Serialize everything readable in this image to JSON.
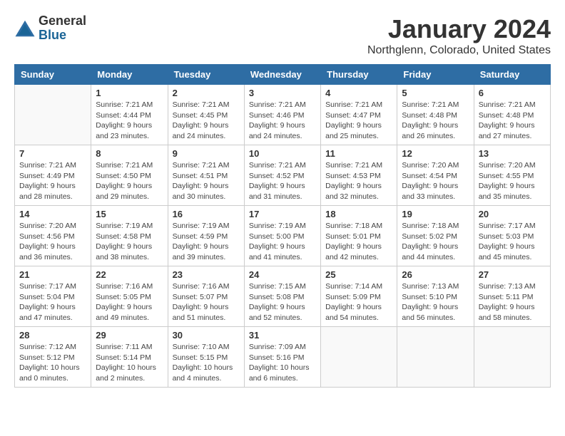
{
  "header": {
    "logo_general": "General",
    "logo_blue": "Blue",
    "title": "January 2024",
    "location": "Northglenn, Colorado, United States"
  },
  "weekdays": [
    "Sunday",
    "Monday",
    "Tuesday",
    "Wednesday",
    "Thursday",
    "Friday",
    "Saturday"
  ],
  "weeks": [
    [
      {
        "day": "",
        "info": ""
      },
      {
        "day": "1",
        "info": "Sunrise: 7:21 AM\nSunset: 4:44 PM\nDaylight: 9 hours\nand 23 minutes."
      },
      {
        "day": "2",
        "info": "Sunrise: 7:21 AM\nSunset: 4:45 PM\nDaylight: 9 hours\nand 24 minutes."
      },
      {
        "day": "3",
        "info": "Sunrise: 7:21 AM\nSunset: 4:46 PM\nDaylight: 9 hours\nand 24 minutes."
      },
      {
        "day": "4",
        "info": "Sunrise: 7:21 AM\nSunset: 4:47 PM\nDaylight: 9 hours\nand 25 minutes."
      },
      {
        "day": "5",
        "info": "Sunrise: 7:21 AM\nSunset: 4:48 PM\nDaylight: 9 hours\nand 26 minutes."
      },
      {
        "day": "6",
        "info": "Sunrise: 7:21 AM\nSunset: 4:48 PM\nDaylight: 9 hours\nand 27 minutes."
      }
    ],
    [
      {
        "day": "7",
        "info": "Sunrise: 7:21 AM\nSunset: 4:49 PM\nDaylight: 9 hours\nand 28 minutes."
      },
      {
        "day": "8",
        "info": "Sunrise: 7:21 AM\nSunset: 4:50 PM\nDaylight: 9 hours\nand 29 minutes."
      },
      {
        "day": "9",
        "info": "Sunrise: 7:21 AM\nSunset: 4:51 PM\nDaylight: 9 hours\nand 30 minutes."
      },
      {
        "day": "10",
        "info": "Sunrise: 7:21 AM\nSunset: 4:52 PM\nDaylight: 9 hours\nand 31 minutes."
      },
      {
        "day": "11",
        "info": "Sunrise: 7:21 AM\nSunset: 4:53 PM\nDaylight: 9 hours\nand 32 minutes."
      },
      {
        "day": "12",
        "info": "Sunrise: 7:20 AM\nSunset: 4:54 PM\nDaylight: 9 hours\nand 33 minutes."
      },
      {
        "day": "13",
        "info": "Sunrise: 7:20 AM\nSunset: 4:55 PM\nDaylight: 9 hours\nand 35 minutes."
      }
    ],
    [
      {
        "day": "14",
        "info": "Sunrise: 7:20 AM\nSunset: 4:56 PM\nDaylight: 9 hours\nand 36 minutes."
      },
      {
        "day": "15",
        "info": "Sunrise: 7:19 AM\nSunset: 4:58 PM\nDaylight: 9 hours\nand 38 minutes."
      },
      {
        "day": "16",
        "info": "Sunrise: 7:19 AM\nSunset: 4:59 PM\nDaylight: 9 hours\nand 39 minutes."
      },
      {
        "day": "17",
        "info": "Sunrise: 7:19 AM\nSunset: 5:00 PM\nDaylight: 9 hours\nand 41 minutes."
      },
      {
        "day": "18",
        "info": "Sunrise: 7:18 AM\nSunset: 5:01 PM\nDaylight: 9 hours\nand 42 minutes."
      },
      {
        "day": "19",
        "info": "Sunrise: 7:18 AM\nSunset: 5:02 PM\nDaylight: 9 hours\nand 44 minutes."
      },
      {
        "day": "20",
        "info": "Sunrise: 7:17 AM\nSunset: 5:03 PM\nDaylight: 9 hours\nand 45 minutes."
      }
    ],
    [
      {
        "day": "21",
        "info": "Sunrise: 7:17 AM\nSunset: 5:04 PM\nDaylight: 9 hours\nand 47 minutes."
      },
      {
        "day": "22",
        "info": "Sunrise: 7:16 AM\nSunset: 5:05 PM\nDaylight: 9 hours\nand 49 minutes."
      },
      {
        "day": "23",
        "info": "Sunrise: 7:16 AM\nSunset: 5:07 PM\nDaylight: 9 hours\nand 51 minutes."
      },
      {
        "day": "24",
        "info": "Sunrise: 7:15 AM\nSunset: 5:08 PM\nDaylight: 9 hours\nand 52 minutes."
      },
      {
        "day": "25",
        "info": "Sunrise: 7:14 AM\nSunset: 5:09 PM\nDaylight: 9 hours\nand 54 minutes."
      },
      {
        "day": "26",
        "info": "Sunrise: 7:13 AM\nSunset: 5:10 PM\nDaylight: 9 hours\nand 56 minutes."
      },
      {
        "day": "27",
        "info": "Sunrise: 7:13 AM\nSunset: 5:11 PM\nDaylight: 9 hours\nand 58 minutes."
      }
    ],
    [
      {
        "day": "28",
        "info": "Sunrise: 7:12 AM\nSunset: 5:12 PM\nDaylight: 10 hours\nand 0 minutes."
      },
      {
        "day": "29",
        "info": "Sunrise: 7:11 AM\nSunset: 5:14 PM\nDaylight: 10 hours\nand 2 minutes."
      },
      {
        "day": "30",
        "info": "Sunrise: 7:10 AM\nSunset: 5:15 PM\nDaylight: 10 hours\nand 4 minutes."
      },
      {
        "day": "31",
        "info": "Sunrise: 7:09 AM\nSunset: 5:16 PM\nDaylight: 10 hours\nand 6 minutes."
      },
      {
        "day": "",
        "info": ""
      },
      {
        "day": "",
        "info": ""
      },
      {
        "day": "",
        "info": ""
      }
    ]
  ]
}
